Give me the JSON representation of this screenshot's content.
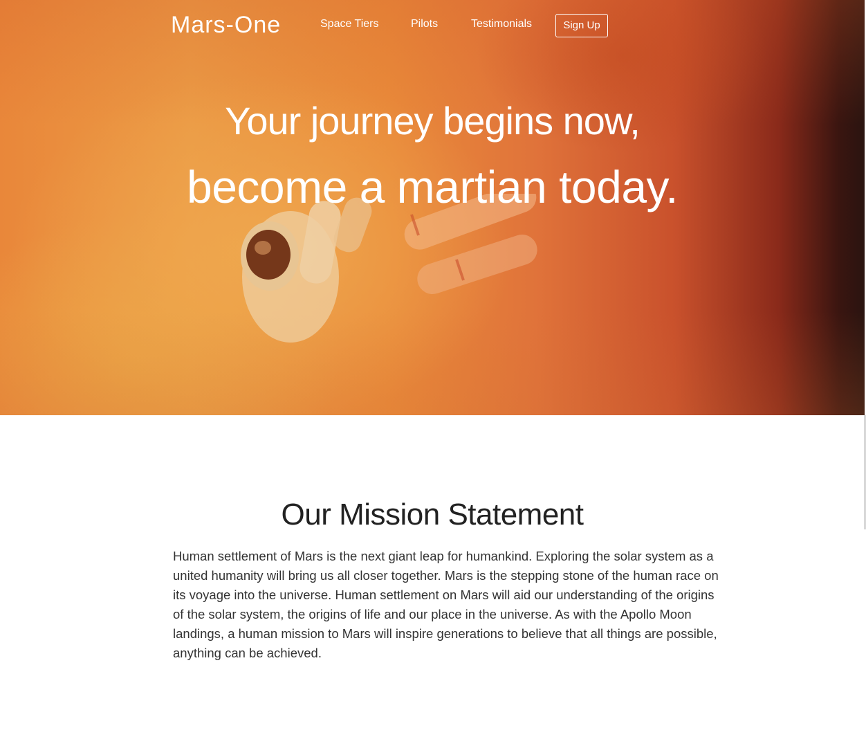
{
  "nav": {
    "brand": "Mars-One",
    "links": [
      "Space Tiers",
      "Pilots",
      "Testimonials"
    ],
    "signup_label": "Sign Up"
  },
  "hero": {
    "line1": "Your journey begins now,",
    "line2": "become a martian today."
  },
  "mission": {
    "title": "Our Mission Statement",
    "text": "Human settlement of Mars is the next giant leap for humankind. Exploring the solar system as a united humanity will bring us all closer together. Mars is the stepping stone of the human race on its voyage into the universe. Human settlement on Mars will aid our understanding of the origins of the solar system, the origins of life and our place in the universe. As with the Apollo Moon landings, a human mission to Mars will inspire generations to believe that all things are possible, anything can be achieved."
  },
  "colors": {
    "hero_orange": "#e9873a",
    "hero_dark": "#2a1410",
    "text_dark": "#333333",
    "white": "#ffffff"
  }
}
